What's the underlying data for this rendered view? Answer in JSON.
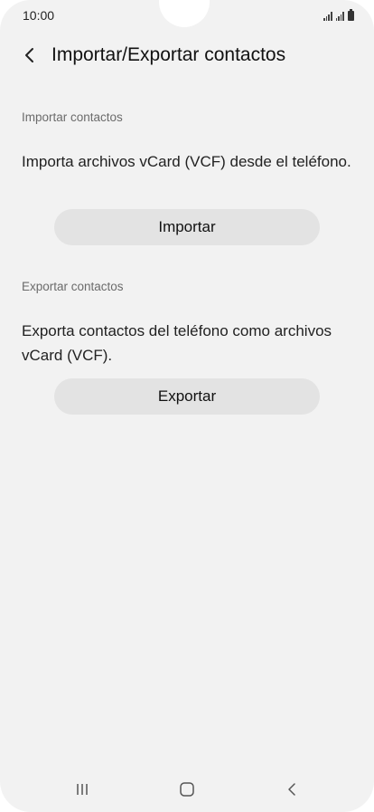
{
  "status_bar": {
    "time": "10:00"
  },
  "header": {
    "back_icon": "chevron-left-icon",
    "title": "Importar/Exportar contactos"
  },
  "import_section": {
    "heading": "Importar contactos",
    "description": "Importa archivos vCard (VCF) desde el teléfono.",
    "button_label": "Importar"
  },
  "export_section": {
    "heading": "Exportar contactos",
    "description": "Exporta contactos del teléfono como archivos vCard (VCF).",
    "button_label": "Exportar"
  },
  "nav_bar": {
    "recents_icon": "recent-apps-icon",
    "home_icon": "home-icon",
    "back_icon": "back-icon"
  },
  "colors": {
    "background": "#f2f2f2",
    "button": "#e3e3e3",
    "text": "#1c1c1c",
    "section_header": "#6b6b6b"
  }
}
